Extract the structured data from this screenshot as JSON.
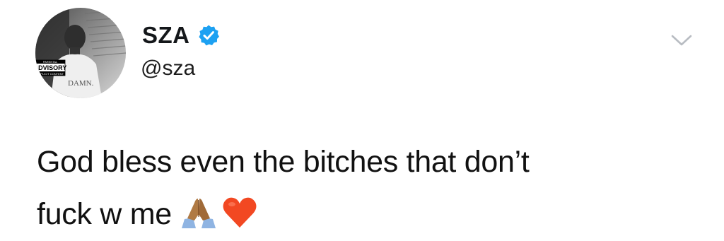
{
  "author": {
    "display_name": "SZA",
    "handle": "@sza",
    "verified": true,
    "avatar": {
      "album_label": "DAMN.",
      "parental_advisory_lines": [
        "PARENTAL",
        "ADVISORY",
        "EXPLICIT CONTENT"
      ]
    }
  },
  "tweet": {
    "text_line_1": "God bless even the bitches that don’t",
    "text_line_2": "fuck w me",
    "emojis": [
      "folded-hands-icon",
      "red-heart-icon"
    ]
  },
  "menu": {
    "icon": "chevron-down-icon"
  },
  "colors": {
    "verified_blue": "#1da1f2",
    "heart_red": "#f24822",
    "text": "#111111",
    "chevron_gray": "#b8bcc2"
  }
}
